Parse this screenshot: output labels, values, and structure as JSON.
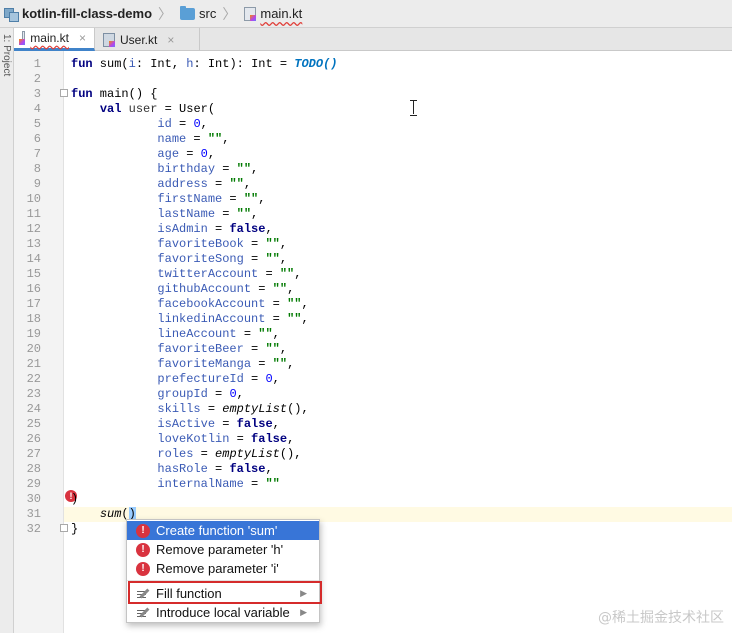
{
  "breadcrumb": {
    "project": "kotlin-fill-class-demo",
    "folder": "src",
    "file": "main.kt",
    "separator": "〉"
  },
  "left_strip": {
    "label": "1: Project"
  },
  "tabs": [
    {
      "label": "main.kt",
      "close": "×",
      "icon": "kotlin-file-icon",
      "active": true
    },
    {
      "label": "User.kt",
      "close": "×",
      "icon": "kotlin-class-icon",
      "active": false
    }
  ],
  "line_numbers": [
    "1",
    "2",
    "3",
    "4",
    "5",
    "6",
    "7",
    "8",
    "9",
    "10",
    "11",
    "12",
    "13",
    "14",
    "15",
    "16",
    "17",
    "18",
    "19",
    "20",
    "21",
    "22",
    "23",
    "24",
    "25",
    "26",
    "27",
    "28",
    "29",
    "30",
    "31",
    "32"
  ],
  "code": {
    "l1": {
      "kw": "fun",
      "name": " sum(",
      "p1": "i",
      "t1": ": Int, ",
      "p2": "h",
      "t2": ": Int): Int = ",
      "todo": "TODO()"
    },
    "l3": {
      "kw": "fun",
      "rest": " main() {"
    },
    "l4": {
      "kw": "val",
      "var": "user",
      "rest": " = User("
    },
    "args": [
      {
        "name": "id",
        "value": "0",
        "kind": "num",
        "comma": ","
      },
      {
        "name": "name",
        "value": "\"\"",
        "kind": "str",
        "comma": ","
      },
      {
        "name": "age",
        "value": "0",
        "kind": "num",
        "comma": ","
      },
      {
        "name": "birthday",
        "value": "\"\"",
        "kind": "str",
        "comma": ","
      },
      {
        "name": "address",
        "value": "\"\"",
        "kind": "str",
        "comma": ","
      },
      {
        "name": "firstName",
        "value": "\"\"",
        "kind": "str",
        "comma": ","
      },
      {
        "name": "lastName",
        "value": "\"\"",
        "kind": "str",
        "comma": ","
      },
      {
        "name": "isAdmin",
        "value": "false",
        "kind": "kw",
        "comma": ","
      },
      {
        "name": "favoriteBook",
        "value": "\"\"",
        "kind": "str",
        "comma": ","
      },
      {
        "name": "favoriteSong",
        "value": "\"\"",
        "kind": "str",
        "comma": ","
      },
      {
        "name": "twitterAccount",
        "value": "\"\"",
        "kind": "str",
        "comma": ","
      },
      {
        "name": "githubAccount",
        "value": "\"\"",
        "kind": "str",
        "comma": ","
      },
      {
        "name": "facebookAccount",
        "value": "\"\"",
        "kind": "str",
        "comma": ","
      },
      {
        "name": "linkedinAccount",
        "value": "\"\"",
        "kind": "str",
        "comma": ","
      },
      {
        "name": "lineAccount",
        "value": "\"\"",
        "kind": "str",
        "comma": ","
      },
      {
        "name": "favoriteBeer",
        "value": "\"\"",
        "kind": "str",
        "comma": ","
      },
      {
        "name": "favoriteManga",
        "value": "\"\"",
        "kind": "str",
        "comma": ","
      },
      {
        "name": "prefectureId",
        "value": "0",
        "kind": "num",
        "comma": ","
      },
      {
        "name": "groupId",
        "value": "0",
        "kind": "num",
        "comma": ","
      },
      {
        "name": "skills",
        "value": "emptyList",
        "kind": "call",
        "comma": "(),"
      },
      {
        "name": "isActive",
        "value": "false",
        "kind": "kw",
        "comma": ","
      },
      {
        "name": "loveKotlin",
        "value": "false",
        "kind": "kw",
        "comma": ","
      },
      {
        "name": "roles",
        "value": "emptyList",
        "kind": "call",
        "comma": "(),"
      },
      {
        "name": "hasRole",
        "value": "false",
        "kind": "kw",
        "comma": ","
      },
      {
        "name": "internalName",
        "value": "\"\"",
        "kind": "str",
        "comma": ""
      }
    ],
    "l30": ")",
    "l31": {
      "call": "sum",
      "open": "(",
      "close": ")"
    },
    "l32": "}"
  },
  "popup": {
    "items": [
      {
        "label": "Create function 'sum'",
        "icon": "error-icon"
      },
      {
        "label": "Remove parameter 'h'",
        "icon": "error-icon"
      },
      {
        "label": "Remove parameter 'i'",
        "icon": "error-icon"
      },
      {
        "label": "Fill function",
        "icon": "intention-icon",
        "arrow": "▶"
      },
      {
        "label": "Introduce local variable",
        "icon": "intention-icon",
        "arrow": "▶"
      }
    ]
  },
  "error_glyph": "!",
  "watermark": "@稀土掘金技术社区",
  "colors": {
    "keyword": "#000080",
    "string": "#007a00",
    "number": "#0000ff",
    "param": "#3b5bb5",
    "selection": "#3875d7",
    "highlight_box": "#d52b2b",
    "current_line": "#fffae3"
  }
}
